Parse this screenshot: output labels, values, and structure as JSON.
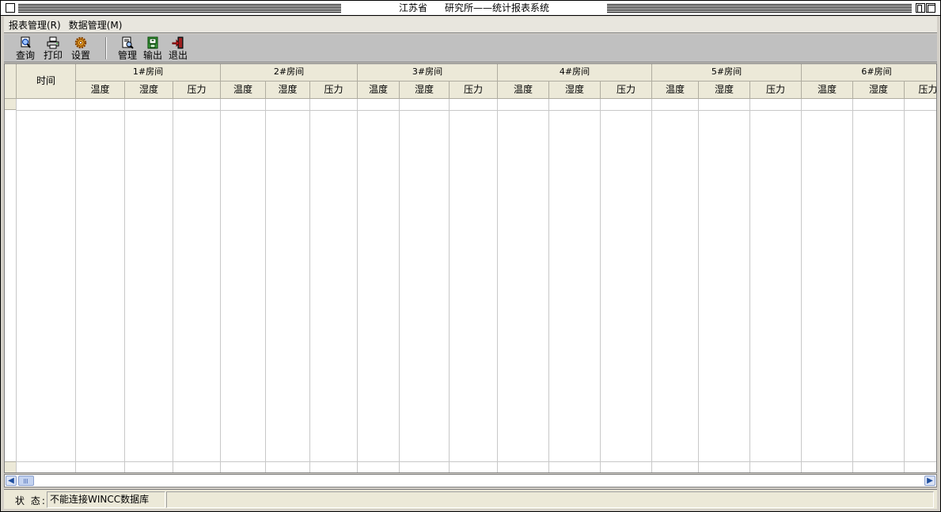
{
  "window": {
    "title_left": "江苏省",
    "title_right": "研究所——统计报表系统"
  },
  "menu": [
    {
      "label": "报表管理(R)"
    },
    {
      "label": "数据管理(M)"
    }
  ],
  "toolbar": {
    "query_label": "查询",
    "print_label": "打印",
    "settings_label": "设置",
    "manage_label": "管理",
    "export_label": "输出",
    "exit_label": "退出"
  },
  "grid": {
    "time_header": "时间",
    "rooms": [
      {
        "name": "1#房间",
        "cols": [
          "温度",
          "湿度",
          "压力"
        ]
      },
      {
        "name": "2#房间",
        "cols": [
          "温度",
          "湿度",
          "压力"
        ]
      },
      {
        "name": "3#房间",
        "cols": [
          "温度",
          "湿度",
          "压力"
        ]
      },
      {
        "name": "4#房间",
        "cols": [
          "温度",
          "湿度",
          "压力"
        ]
      },
      {
        "name": "5#房间",
        "cols": [
          "温度",
          "湿度",
          "压力"
        ]
      },
      {
        "name": "6#房间",
        "cols": [
          "温度",
          "湿度",
          "压力"
        ]
      }
    ]
  },
  "status": {
    "label": "状 态:",
    "message": "不能连接WINCC数据库"
  },
  "colors": {
    "header_bg": "#ece9d8",
    "grid_line": "#c8c8c8",
    "toolbar_bg": "#c0c0c0"
  }
}
